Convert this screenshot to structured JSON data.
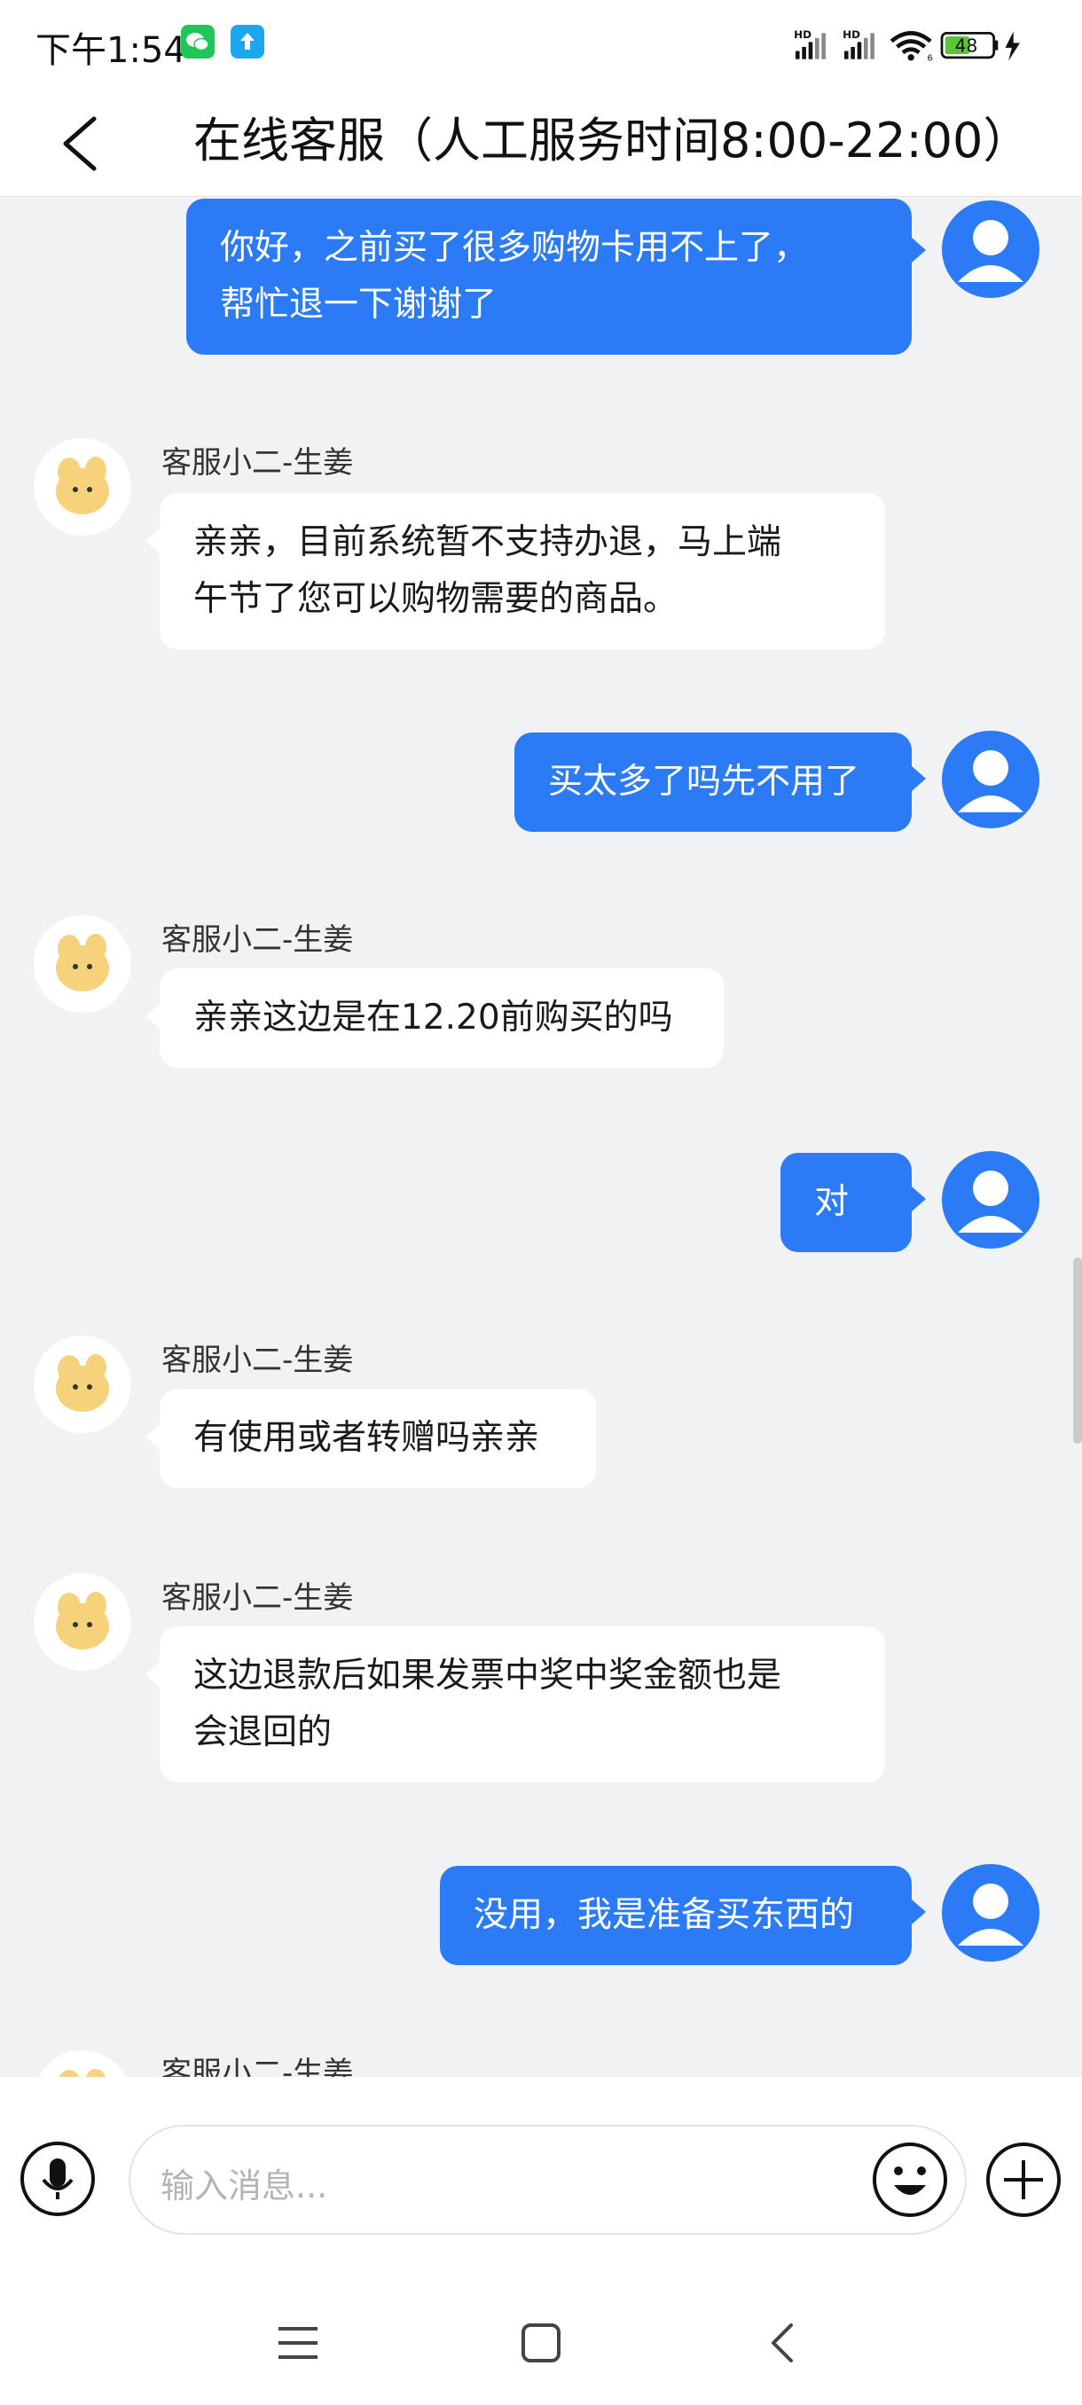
{
  "status_bar": {
    "time": "下午1:54",
    "battery_level": "48",
    "signal_tag_1": "HD",
    "signal_tag_2": "HD",
    "wifi_tag": "6"
  },
  "header": {
    "title": "在线客服（人工服务时间8:00-22:00）"
  },
  "messages": [
    {
      "from": "user",
      "text_lines": [
        "你好，之前买了很多购物卡用不上了，",
        "帮忙退一下谢谢了"
      ]
    },
    {
      "from": "agent",
      "name": "客服小二-生姜",
      "text_lines": [
        "亲亲，目前系统暂不支持办退，马上端",
        "午节了您可以购物需要的商品。"
      ]
    },
    {
      "from": "user",
      "text_lines": [
        "买太多了吗先不用了"
      ]
    },
    {
      "from": "agent",
      "name": "客服小二-生姜",
      "text_lines": [
        "亲亲这边是在12.20前购买的吗"
      ]
    },
    {
      "from": "user",
      "text_lines": [
        "对"
      ]
    },
    {
      "from": "agent",
      "name": "客服小二-生姜",
      "text_lines": [
        "有使用或者转赠吗亲亲"
      ]
    },
    {
      "from": "agent",
      "name": "客服小二-生姜",
      "text_lines": [
        "这边退款后如果发票中奖中奖金额也是",
        "会退回的"
      ]
    },
    {
      "from": "user",
      "text_lines": [
        "没用，我是准备买东西的"
      ]
    },
    {
      "from": "agent",
      "name": "客服小二-生姜",
      "text_lines": []
    }
  ],
  "input": {
    "placeholder": "输入消息..."
  },
  "colors": {
    "user_bubble": "#2b7bf6",
    "agent_bubble": "#ffffff",
    "chat_background": "#f1f2f4"
  },
  "icons": [
    "back-icon",
    "mic-icon",
    "emoji-icon",
    "plus-icon",
    "menu-icon",
    "home-icon",
    "nav-back-icon",
    "wechat-icon",
    "upload-icon",
    "wifi-icon",
    "battery-icon",
    "charging-icon"
  ]
}
